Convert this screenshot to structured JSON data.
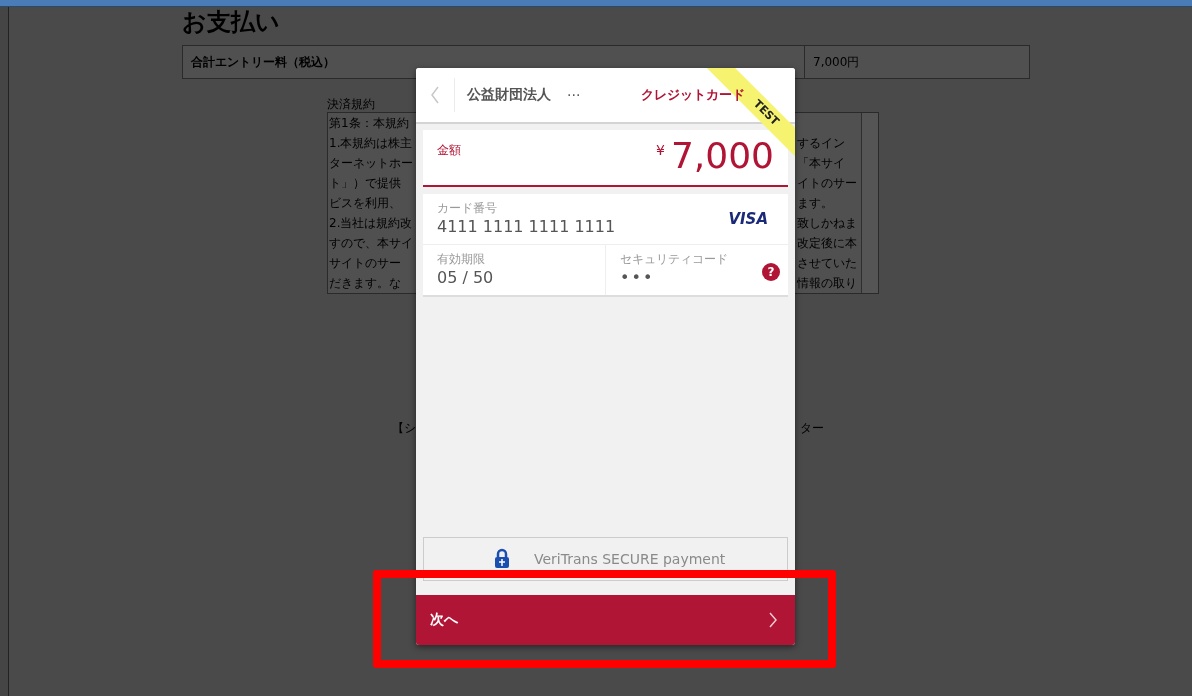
{
  "page": {
    "title": "お支払い",
    "fee_row": {
      "label": "合計エントリー料（税込）",
      "value": "7,000円"
    },
    "terms": {
      "label": "決済規約",
      "left_lines": [
        "第1条：本規約",
        "1.本規約は株主",
        "ターネットホー",
        "ト」）で提供",
        "ビスを利用、",
        "2.当社は規約改",
        "すので、本サイ",
        "サイトのサー",
        "だきます。な"
      ],
      "right_lines": [
        "するイン",
        "「本サイ",
        "イトのサー",
        "ます。",
        "致しかねま",
        "改定後に本",
        "させていた",
        "情報の取り"
      ]
    },
    "footer_fragments": [
      "【シ",
      "ター"
    ]
  },
  "modal": {
    "header": {
      "title": "公益財団法人",
      "more": "···",
      "payment_method": "クレジットカード",
      "test_ribbon": "TEST"
    },
    "amount": {
      "label": "金額",
      "currency": "¥",
      "value": "7,000"
    },
    "card": {
      "number_label": "カード番号",
      "number": "4111 1111 1111 1111",
      "brand": "VISA",
      "expiry_label": "有効期限",
      "expiry": "05 / 50",
      "cvc_label": "セキュリティコード",
      "cvc": "•••",
      "help": "?"
    },
    "secure_badge": "VeriTrans SECURE payment",
    "next_button": "次へ"
  }
}
